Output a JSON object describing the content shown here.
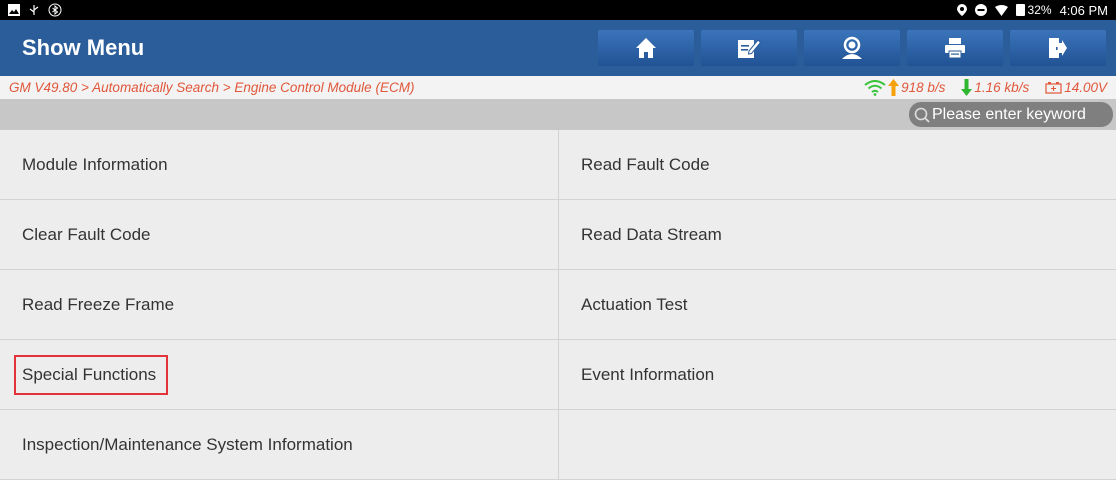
{
  "statusbar": {
    "time": "4:06 PM",
    "battery": "32%",
    "icons": [
      "image-icon",
      "usb-icon",
      "bluetooth-icon",
      "location-icon",
      "do-not-disturb-icon",
      "wifi-icon",
      "battery-icon"
    ]
  },
  "header": {
    "title": "Show Menu",
    "toolbar": [
      "home-icon",
      "edit-icon",
      "remote-support-icon",
      "print-icon",
      "exit-icon"
    ]
  },
  "breadcrumb": "GM V49.80 > Automatically Search > Engine Control Module (ECM)",
  "status": {
    "upload": "918 b/s",
    "download": "1.16 kb/s",
    "voltage": "14.00V",
    "colors": {
      "wifi": "#39c43a",
      "upload": "#f5a10b",
      "download": "#2fb52f",
      "text": "#e0573b"
    }
  },
  "search": {
    "placeholder": "Please enter keyword"
  },
  "menu": {
    "items": [
      "Module Information",
      "Read Fault Code",
      "Clear Fault Code",
      "Read Data Stream",
      "Read Freeze Frame",
      "Actuation Test",
      "Special Functions",
      "Event Information",
      "Inspection/Maintenance System Information",
      ""
    ],
    "highlighted": "Special Functions",
    "highlight_color": "#e3343c"
  }
}
